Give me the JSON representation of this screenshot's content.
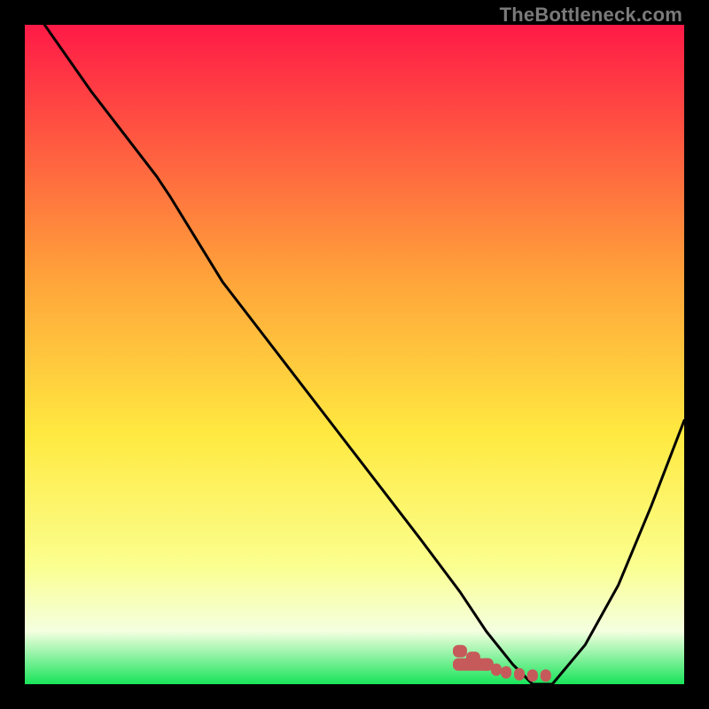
{
  "watermark": "TheBottleneck.com",
  "colors": {
    "gradient_top": "#ff1a47",
    "gradient_upper_mid": "#ffa23a",
    "gradient_mid": "#ffe940",
    "gradient_lower_mid": "#fbff8f",
    "gradient_low": "#f4ffe0",
    "gradient_bottom": "#18e45a",
    "curve": "#000000",
    "marker": "#c65a5a",
    "background": "#000000",
    "plot_bg": "#ffffff"
  },
  "chart_data": {
    "type": "line",
    "title": "",
    "xlabel": "",
    "ylabel": "",
    "xlim": [
      0,
      100
    ],
    "ylim": [
      0,
      100
    ],
    "series": [
      {
        "name": "bottleneck-curve",
        "x": [
          3,
          10,
          20,
          22,
          30,
          40,
          50,
          60,
          66,
          70,
          74,
          77,
          80,
          85,
          90,
          95,
          100
        ],
        "y": [
          100,
          90,
          77,
          74,
          61,
          48,
          35,
          22,
          14,
          8,
          3,
          0,
          0,
          6,
          15,
          27,
          40
        ]
      }
    ],
    "markers": {
      "name": "highlight-dots",
      "x": [
        66,
        68,
        70,
        71.5,
        73,
        75,
        77,
        79
      ],
      "y": [
        5,
        4,
        3,
        2.2,
        1.8,
        1.5,
        1.3,
        1.3
      ]
    }
  }
}
